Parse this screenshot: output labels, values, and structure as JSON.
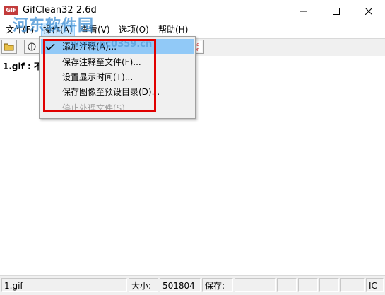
{
  "window": {
    "app_icon_text": "GIF",
    "title": "GifClean32 2.6d",
    "watermark": "河东软件园",
    "watermark_url": "www.pc0359.cn"
  },
  "menubar": {
    "items": [
      {
        "label": "文件(F)"
      },
      {
        "label": "操作(A)"
      },
      {
        "label": "查看(V)"
      },
      {
        "label": "选项(O)"
      },
      {
        "label": "帮助(H)"
      }
    ]
  },
  "content": {
    "file_label": "1.gif : 不"
  },
  "dropdown": {
    "items": [
      {
        "label": "添加注释(A)...",
        "checked": true,
        "enabled": true
      },
      {
        "label": "保存注释至文件(F)...",
        "enabled": true
      },
      {
        "label": "设置显示时间(T)...",
        "enabled": true
      },
      {
        "label": "保存图像至预设目录(D)...",
        "enabled": true
      },
      {
        "label": "停止处理文件(S)",
        "enabled": false
      }
    ]
  },
  "statusbar": {
    "filename": "1.gif",
    "size_label": "大小:",
    "size_value": "501804",
    "save_label": "保存:",
    "mode": "IC"
  },
  "colors": {
    "highlight": "#91c9f7",
    "annotation_box": "#e00000",
    "menu_active": "#cce8ff"
  }
}
